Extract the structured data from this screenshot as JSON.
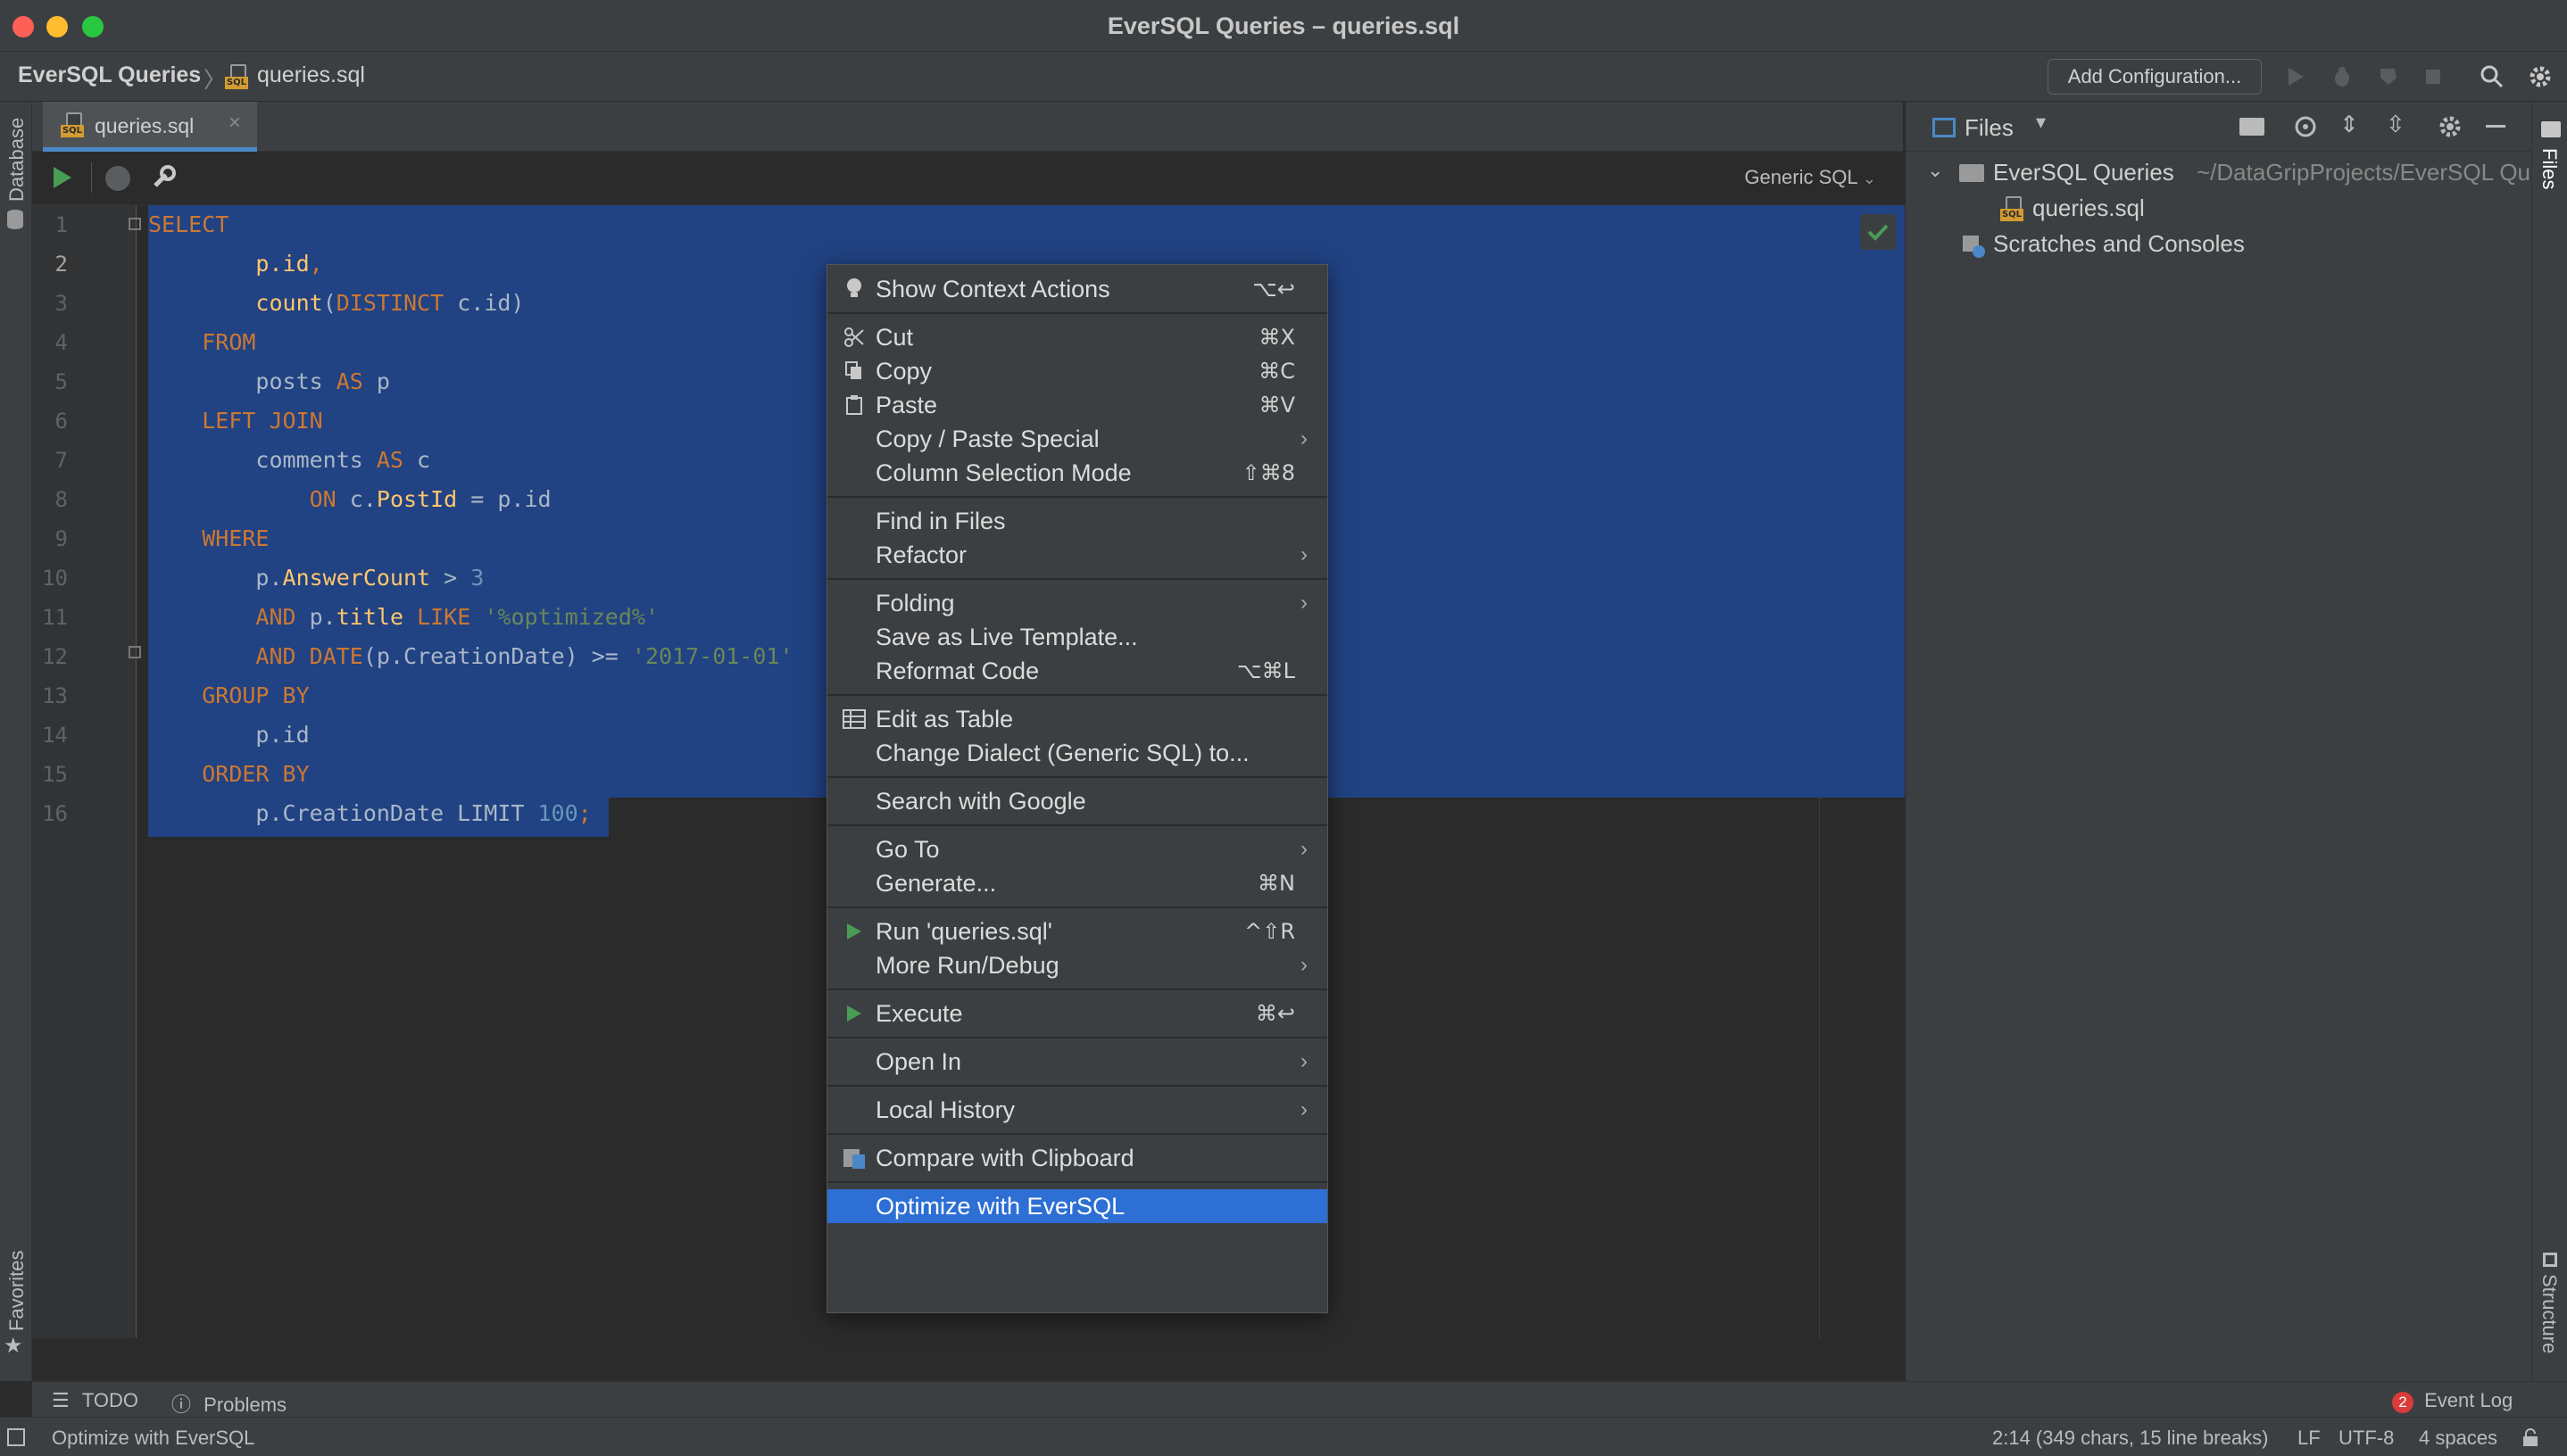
{
  "window": {
    "title": "EverSQL Queries – queries.sql"
  },
  "navbar": {
    "project": "EverSQL Queries",
    "file": "queries.sql",
    "add_configuration": "Add Configuration..."
  },
  "tabs": [
    {
      "label": "queries.sql"
    }
  ],
  "side_labels": {
    "database": "Database",
    "favorites": "Favorites",
    "files": "Files",
    "structure": "Structure"
  },
  "editor": {
    "dialect": "Generic SQL",
    "lines": [
      {
        "n": "1",
        "tokens": [
          [
            "kw",
            "SELECT"
          ]
        ]
      },
      {
        "n": "2",
        "tokens": [
          [
            "id",
            "        "
          ],
          [
            "fld",
            "p.id"
          ],
          [
            "punct",
            ","
          ]
        ]
      },
      {
        "n": "3",
        "tokens": [
          [
            "id",
            "        "
          ],
          [
            "fn",
            "count"
          ],
          [
            "id",
            "("
          ],
          [
            "kw",
            "DISTINCT"
          ],
          [
            "id",
            " c.id)"
          ]
        ]
      },
      {
        "n": "4",
        "tokens": [
          [
            "id",
            "    "
          ],
          [
            "kw",
            "FROM"
          ]
        ]
      },
      {
        "n": "5",
        "tokens": [
          [
            "id",
            "        posts "
          ],
          [
            "kw",
            "AS"
          ],
          [
            "id",
            " p"
          ]
        ]
      },
      {
        "n": "6",
        "tokens": [
          [
            "id",
            "    "
          ],
          [
            "kw",
            "LEFT JOIN"
          ]
        ]
      },
      {
        "n": "7",
        "tokens": [
          [
            "id",
            "        comments "
          ],
          [
            "kw",
            "AS"
          ],
          [
            "id",
            " c"
          ]
        ]
      },
      {
        "n": "8",
        "tokens": [
          [
            "id",
            "            "
          ],
          [
            "kw",
            "ON"
          ],
          [
            "id",
            " c."
          ],
          [
            "fld",
            "PostId"
          ],
          [
            "id",
            " = p.id"
          ]
        ]
      },
      {
        "n": "9",
        "tokens": [
          [
            "id",
            "    "
          ],
          [
            "kw",
            "WHERE"
          ]
        ]
      },
      {
        "n": "10",
        "tokens": [
          [
            "id",
            "        p."
          ],
          [
            "fld",
            "AnswerCount"
          ],
          [
            "id",
            " > "
          ],
          [
            "num",
            "3"
          ]
        ]
      },
      {
        "n": "11",
        "tokens": [
          [
            "id",
            "        "
          ],
          [
            "kw",
            "AND"
          ],
          [
            "id",
            " p."
          ],
          [
            "fld",
            "title"
          ],
          [
            "id",
            " "
          ],
          [
            "kw",
            "LIKE"
          ],
          [
            "id",
            " "
          ],
          [
            "str",
            "'%optimized%'"
          ]
        ]
      },
      {
        "n": "12",
        "tokens": [
          [
            "id",
            "        "
          ],
          [
            "kw",
            "AND"
          ],
          [
            "id",
            " "
          ],
          [
            "kw",
            "DATE"
          ],
          [
            "id",
            "(p.CreationDate) >= "
          ],
          [
            "str",
            "'2017-01-01'"
          ]
        ]
      },
      {
        "n": "13",
        "tokens": [
          [
            "id",
            "    "
          ],
          [
            "kw",
            "GROUP BY"
          ]
        ]
      },
      {
        "n": "14",
        "tokens": [
          [
            "id",
            "        p.id"
          ]
        ]
      },
      {
        "n": "15",
        "tokens": [
          [
            "id",
            "    "
          ],
          [
            "kw",
            "ORDER BY"
          ]
        ]
      },
      {
        "n": "16",
        "tokens": [
          [
            "id",
            "        p.CreationDate LIMIT "
          ],
          [
            "num",
            "100"
          ],
          [
            "punct",
            ";"
          ]
        ]
      }
    ]
  },
  "files_panel": {
    "title": "Files",
    "root": "EverSQL Queries",
    "root_path": "~/DataGripProjects/EverSQL Qu",
    "file": "queries.sql",
    "scratches": "Scratches and Consoles"
  },
  "context_menu": {
    "groups": [
      [
        {
          "label": "Show Context Actions",
          "shortcut": "⌥↩",
          "icon": "bulb-icon"
        }
      ],
      [
        {
          "label": "Cut",
          "shortcut": "⌘X",
          "icon": "scissors-icon"
        },
        {
          "label": "Copy",
          "shortcut": "⌘C",
          "icon": "copy-icon"
        },
        {
          "label": "Paste",
          "shortcut": "⌘V",
          "icon": "paste-icon"
        },
        {
          "label": "Copy / Paste Special",
          "submenu": true
        },
        {
          "label": "Column Selection Mode",
          "shortcut": "⇧⌘8"
        }
      ],
      [
        {
          "label": "Find in Files"
        },
        {
          "label": "Refactor",
          "submenu": true
        }
      ],
      [
        {
          "label": "Folding",
          "submenu": true
        },
        {
          "label": "Save as Live Template..."
        },
        {
          "label": "Reformat Code",
          "shortcut": "⌥⌘L"
        }
      ],
      [
        {
          "label": "Edit as Table",
          "icon": "table-icon"
        },
        {
          "label": "Change Dialect (Generic SQL) to..."
        }
      ],
      [
        {
          "label": "Search with Google"
        }
      ],
      [
        {
          "label": "Go To",
          "submenu": true
        },
        {
          "label": "Generate...",
          "shortcut": "⌘N"
        }
      ],
      [
        {
          "label": "Run 'queries.sql'",
          "shortcut": "^⇧R",
          "icon": "run-icon"
        },
        {
          "label": "More Run/Debug",
          "submenu": true
        }
      ],
      [
        {
          "label": "Execute",
          "shortcut": "⌘↩",
          "icon": "run-icon"
        }
      ],
      [
        {
          "label": "Open In",
          "submenu": true
        }
      ],
      [
        {
          "label": "Local History",
          "submenu": true
        }
      ],
      [
        {
          "label": "Compare with Clipboard",
          "icon": "compare-icon"
        }
      ],
      [
        {
          "label": "Optimize with EverSQL",
          "active": true
        }
      ]
    ]
  },
  "bottom": {
    "todo": "TODO",
    "problems": "Problems",
    "event_log": "Event Log",
    "event_count": "2"
  },
  "status": {
    "message": "Optimize with EverSQL",
    "position": "2:14 (349 chars, 15 line breaks)",
    "line_sep": "LF",
    "encoding": "UTF-8",
    "indent": "4 spaces"
  },
  "colors": {
    "selection": "#214283",
    "menu_active": "#2d6fd4",
    "accent": "#4a88c7"
  }
}
